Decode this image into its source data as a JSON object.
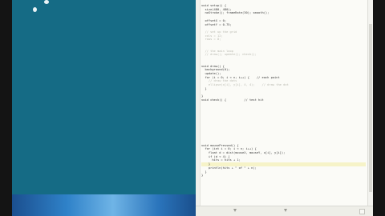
{
  "desktop": {
    "color": "#156b85",
    "taskbar_color": "#2f82c9"
  },
  "editor": {
    "background": "#fbfbf7",
    "highlight_color": "#f6f3c8",
    "lines": [
      {
        "text": "void setup() {",
        "type": "code",
        "hl": false
      },
      {
        "text": "  size(480, 480);",
        "type": "code",
        "hl": false
      },
      {
        "text": "  noStroke(); frameRate(30); smooth();",
        "type": "code",
        "hl": false
      },
      {
        "text": "",
        "type": "code",
        "hl": false
      },
      {
        "text": "  offsetX = 0;",
        "type": "code",
        "hl": false
      },
      {
        "text": "  offsetY = 0.75;",
        "type": "code",
        "hl": false
      },
      {
        "text": "",
        "type": "code",
        "hl": false
      },
      {
        "text": "  // set up the grid",
        "type": "comment",
        "hl": false
      },
      {
        "text": "  cols = 12;",
        "type": "comment",
        "hl": false
      },
      {
        "text": "  rows = 8;",
        "type": "comment",
        "hl": false
      },
      {
        "text": "",
        "type": "code",
        "hl": false
      },
      {
        "text": "",
        "type": "code",
        "hl": false
      },
      {
        "text": "  // the main loop",
        "type": "comment",
        "hl": false
      },
      {
        "text": "  // draw(); update(); check();",
        "type": "comment",
        "hl": false
      },
      {
        "text": "",
        "type": "code",
        "hl": false
      },
      {
        "text": "",
        "type": "code",
        "hl": false
      },
      {
        "text": "void draw() {",
        "type": "code",
        "hl": false
      },
      {
        "text": "  background(0);",
        "type": "code",
        "hl": false
      },
      {
        "text": "  update();",
        "type": "code",
        "hl": false
      },
      {
        "text": "  for (i = 0; i < n; i++) {    // each point",
        "type": "code",
        "hl": false
      },
      {
        "text": "    // draw the dots",
        "type": "comment",
        "hl": false
      },
      {
        "text": "    ellipse(x[i], y[i], 4, 4);    // draw the dot",
        "type": "comment",
        "hl": false
      },
      {
        "text": "  }",
        "type": "code",
        "hl": false
      },
      {
        "text": "",
        "type": "code",
        "hl": false
      },
      {
        "text": "}",
        "type": "code",
        "hl": false
      },
      {
        "text": "void check() {          // test hit",
        "type": "code",
        "hl": false
      },
      {
        "text": "",
        "type": "code",
        "hl": false
      },
      {
        "text": "",
        "type": "code",
        "hl": false
      },
      {
        "text": "",
        "type": "code",
        "hl": false
      },
      {
        "text": "",
        "type": "code",
        "hl": false
      },
      {
        "text": "",
        "type": "code",
        "hl": false
      },
      {
        "text": "",
        "type": "code",
        "hl": false
      },
      {
        "text": "",
        "type": "code",
        "hl": false
      },
      {
        "text": "",
        "type": "code",
        "hl": false
      },
      {
        "text": "",
        "type": "code",
        "hl": false
      },
      {
        "text": "",
        "type": "code",
        "hl": false
      },
      {
        "text": "",
        "type": "code",
        "hl": false
      },
      {
        "text": "void mousePressed() {",
        "type": "code",
        "hl": false
      },
      {
        "text": "  for (int i = 0; i < n; i++) {",
        "type": "code",
        "hl": false
      },
      {
        "text": "    float d = dist(mouseX, mouseY, x[i], y[i]);",
        "type": "code",
        "hl": false
      },
      {
        "text": "    if (d < 4) {",
        "type": "code",
        "hl": false
      },
      {
        "text": "      hits = hits + 1;",
        "type": "code",
        "hl": false
      },
      {
        "text": "    }",
        "type": "code",
        "hl": true
      },
      {
        "text": "    println(hits + \" of \" + n);",
        "type": "code",
        "hl": false
      },
      {
        "text": "  }",
        "type": "code",
        "hl": false
      },
      {
        "text": "}",
        "type": "code",
        "hl": false
      },
      {
        "text": "",
        "type": "code",
        "hl": false
      },
      {
        "text": "",
        "type": "code",
        "hl": false
      },
      {
        "text": "",
        "type": "code",
        "hl": false
      },
      {
        "text": "",
        "type": "code",
        "hl": false
      },
      {
        "text": "",
        "type": "code",
        "hl": false
      },
      {
        "text": "",
        "type": "code",
        "hl": false
      },
      {
        "text": "",
        "type": "code",
        "hl": false
      },
      {
        "text": "",
        "type": "code",
        "hl": false
      }
    ]
  },
  "icons": {
    "status_left": "arrow-down-icon",
    "status_mid": "arrow-down-icon",
    "status_right": "resize-grip-icon"
  }
}
